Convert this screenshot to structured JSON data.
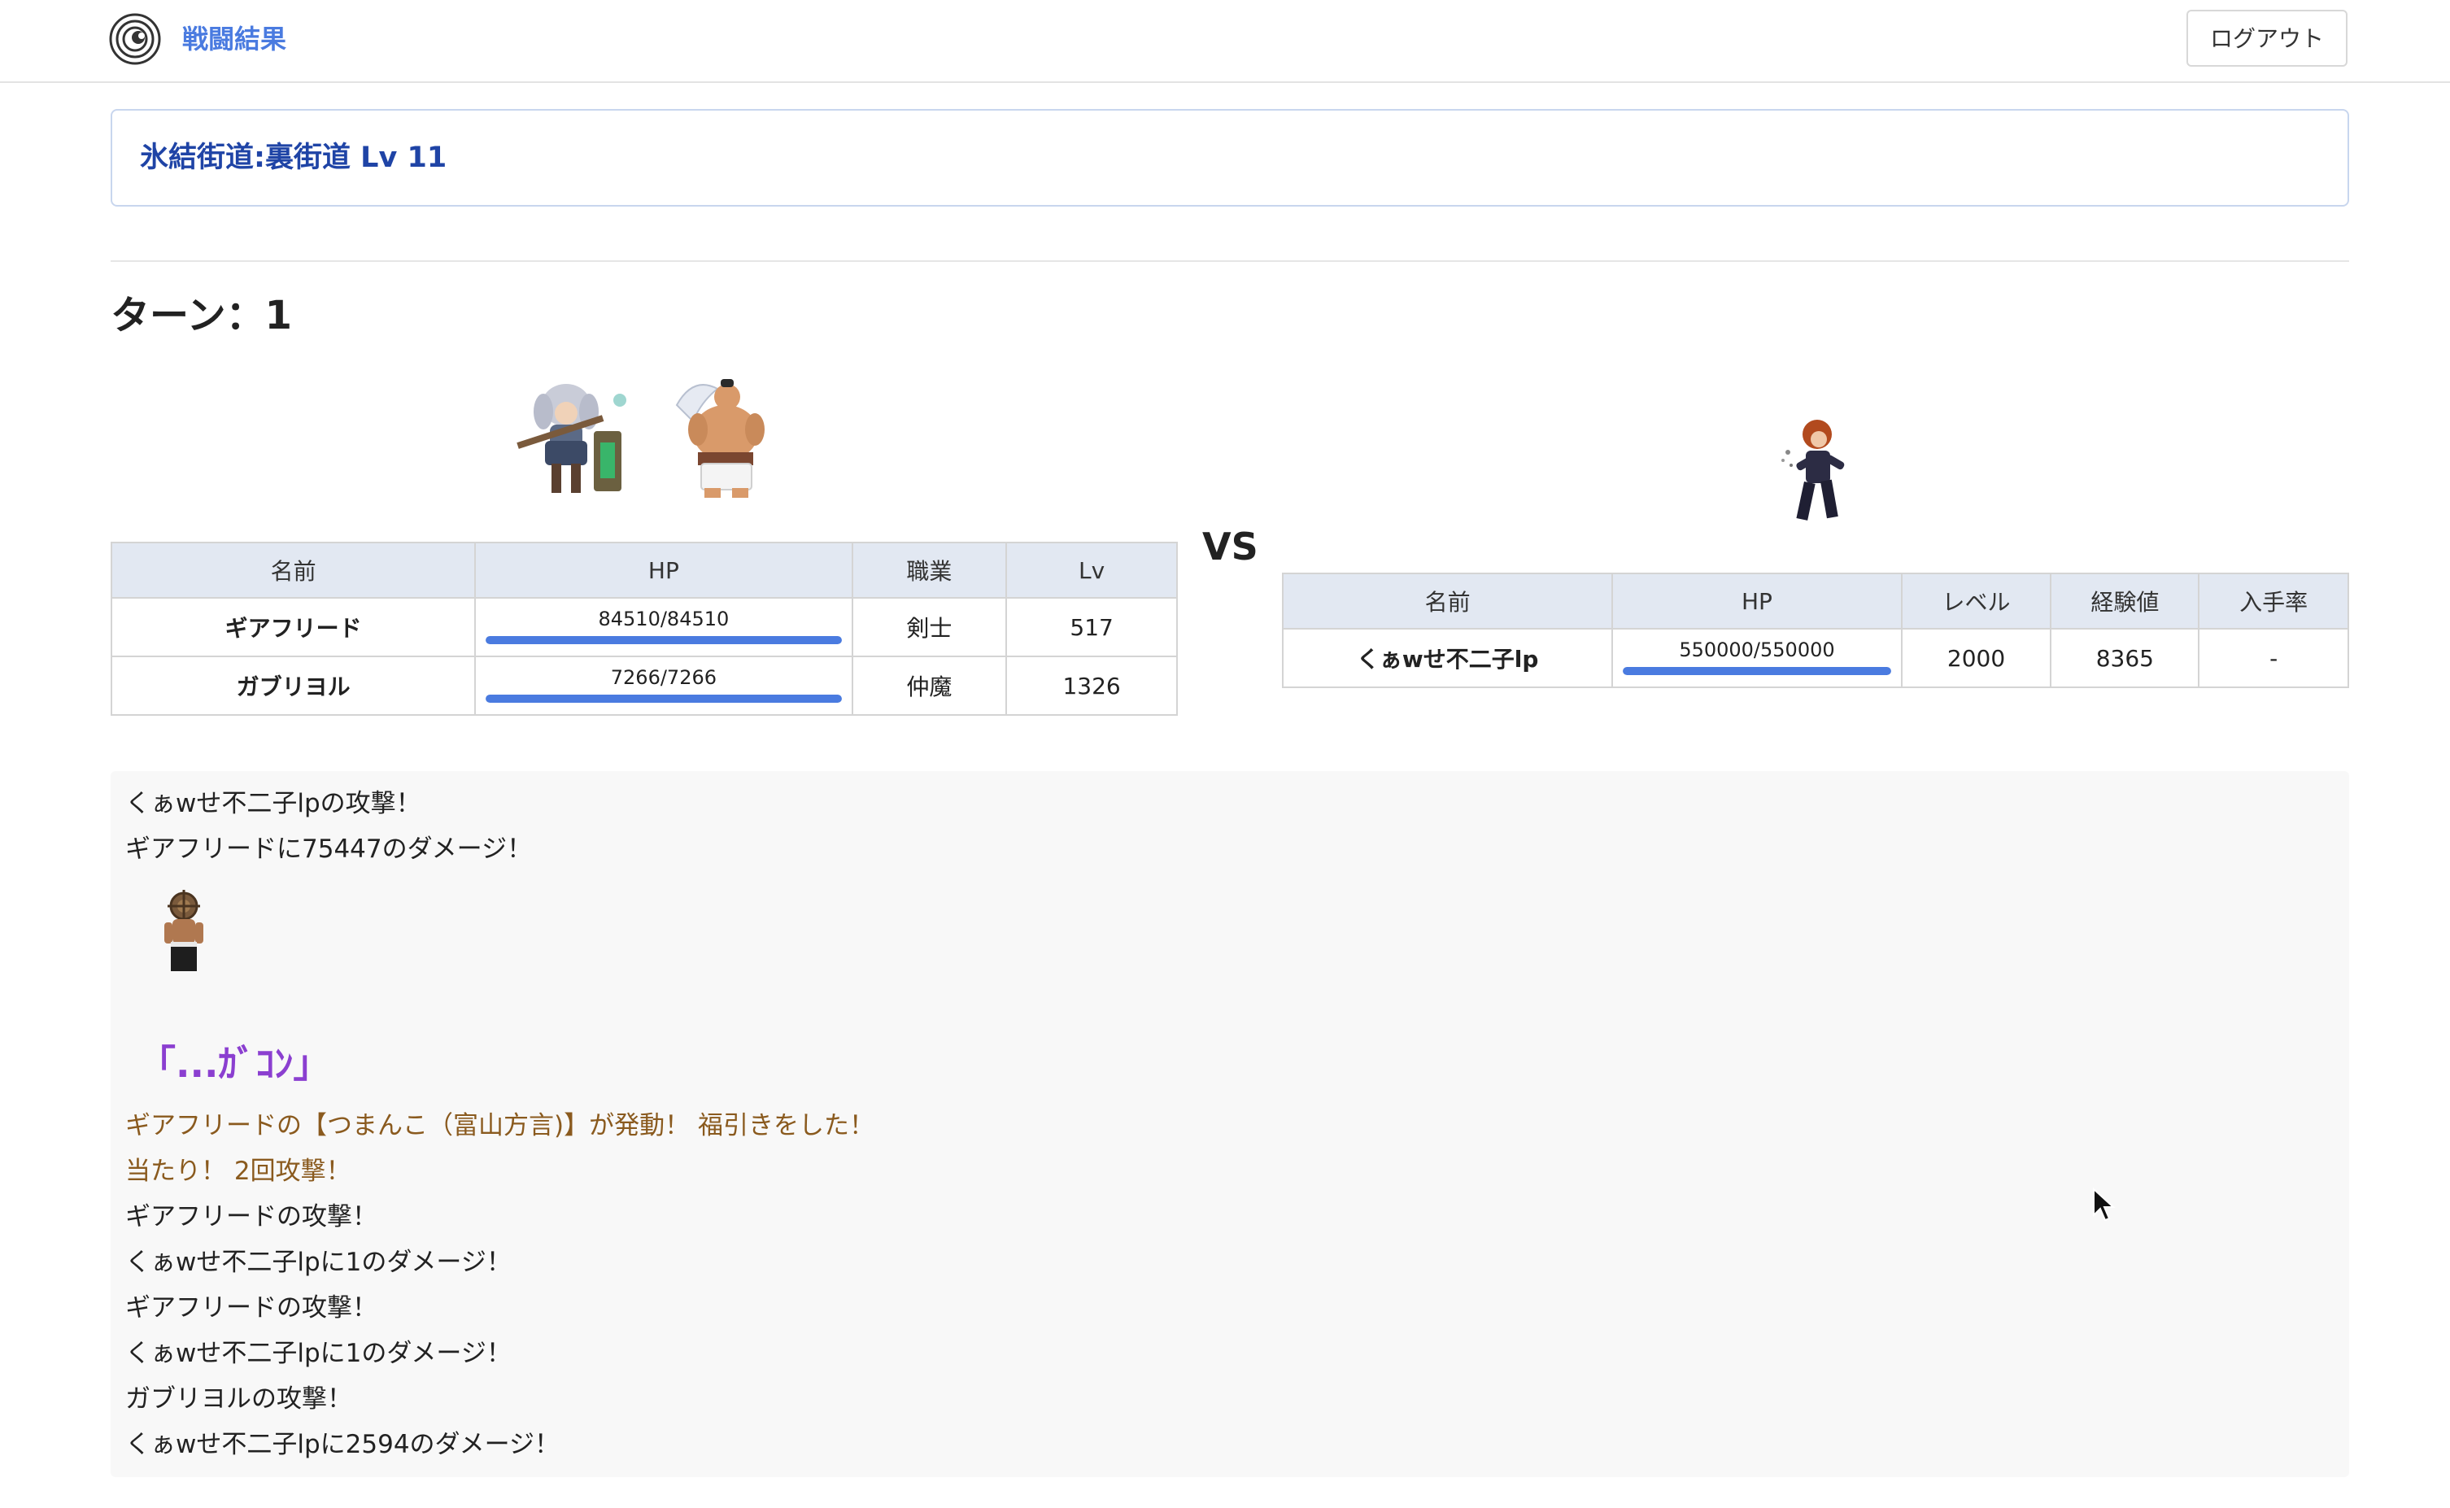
{
  "header": {
    "app_title": "戦闘結果",
    "logout_label": "ログアウト"
  },
  "location": {
    "title": "氷結街道:裏街道 Lv 11"
  },
  "turn": {
    "label": "ターン：1"
  },
  "vs_label": "VS",
  "party_table": {
    "headers": [
      "名前",
      "HP",
      "職業",
      "Lv"
    ],
    "rows": [
      {
        "name": "ギアフリード",
        "hp": "84510/84510",
        "hp_ratio": 1.0,
        "job": "剣士",
        "lv": "517"
      },
      {
        "name": "ガブリヨル",
        "hp": "7266/7266",
        "hp_ratio": 1.0,
        "job": "仲魔",
        "lv": "1326"
      }
    ]
  },
  "enemy_table": {
    "headers": [
      "名前",
      "HP",
      "レベル",
      "経験値",
      "入手率"
    ],
    "rows": [
      {
        "name": "くぁwせ不二子lp",
        "hp": "550000/550000",
        "hp_ratio": 1.0,
        "level": "2000",
        "exp": "8365",
        "rate": "-"
      }
    ]
  },
  "log": {
    "lines_before": [
      "くぁwせ不二子lpの攻撃！",
      "ギアフリードに75447のダメージ！"
    ],
    "quote": "「...ｶﾞｺﾝ」",
    "skill_lines": [
      "ギアフリードの【つまんこ（富山方言)】が発動！ 福引きをした！",
      "当たり！ 2回攻撃！"
    ],
    "lines_after": [
      "ギアフリードの攻撃！",
      "くぁwせ不二子lpに1のダメージ！",
      "ギアフリードの攻撃！",
      "くぁwせ不二子lpに1のダメージ！",
      "ガブリヨルの攻撃！",
      "くぁwせ不二子lpに2594のダメージ！"
    ]
  },
  "colors": {
    "accent": "#4a7be0",
    "location_text": "#1f44a6",
    "quote": "#8b3fd0",
    "skill_text": "#8a5a1e"
  },
  "icons": [
    "logo-icon",
    "mouse-cursor-icon"
  ]
}
